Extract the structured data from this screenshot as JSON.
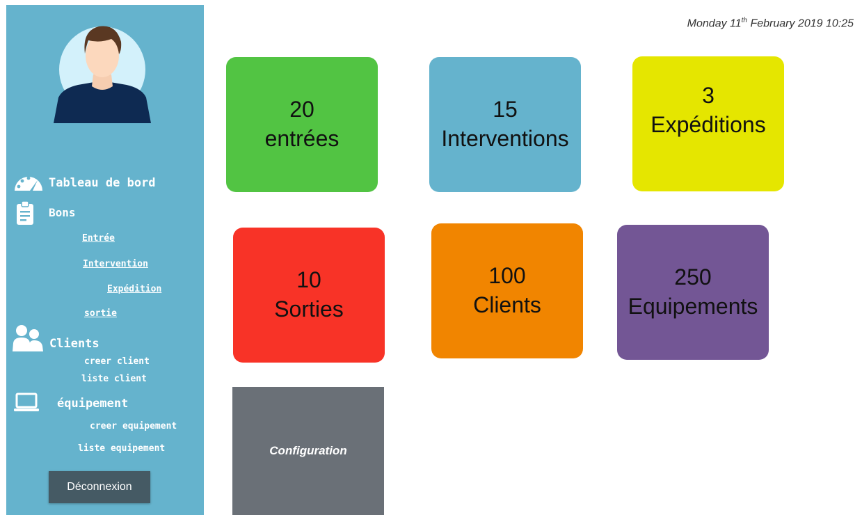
{
  "header": {
    "date_before": "Monday 11",
    "date_sup": "th",
    "date_after": " February 2019 10:25"
  },
  "sidebar": {
    "avatar_icon": "user-avatar-icon",
    "menu": {
      "dashboard": {
        "label": "Tableau de bord",
        "icon": "dashboard-gauge-icon"
      },
      "bons": {
        "label": "Bons",
        "icon": "clipboard-icon",
        "items": [
          "Entrée",
          "Intervention",
          "Expédition",
          "sortie"
        ]
      },
      "clients": {
        "label": "Clients",
        "icon": "users-icon",
        "items": [
          "creer client",
          "liste client"
        ]
      },
      "equipement": {
        "label": "équipement",
        "icon": "laptop-icon",
        "items": [
          "creer equipement",
          "liste equipement"
        ]
      }
    },
    "logout_label": "Déconnexion"
  },
  "tiles": [
    {
      "count": "20",
      "label": "entrées",
      "color": "#52c443"
    },
    {
      "count": "15",
      "label": "Interventions",
      "color": "#65b3cd"
    },
    {
      "count": "3",
      "label": "Expéditions",
      "color": "#e5e600"
    },
    {
      "count": "10",
      "label": "Sorties",
      "color": "#f83327"
    },
    {
      "count": "100",
      "label": "Clients",
      "color": "#f18500"
    },
    {
      "count": "250",
      "label": "Equipements",
      "color": "#735695"
    }
  ],
  "config_tile": {
    "label": "Configuration",
    "color": "#6a7077"
  }
}
